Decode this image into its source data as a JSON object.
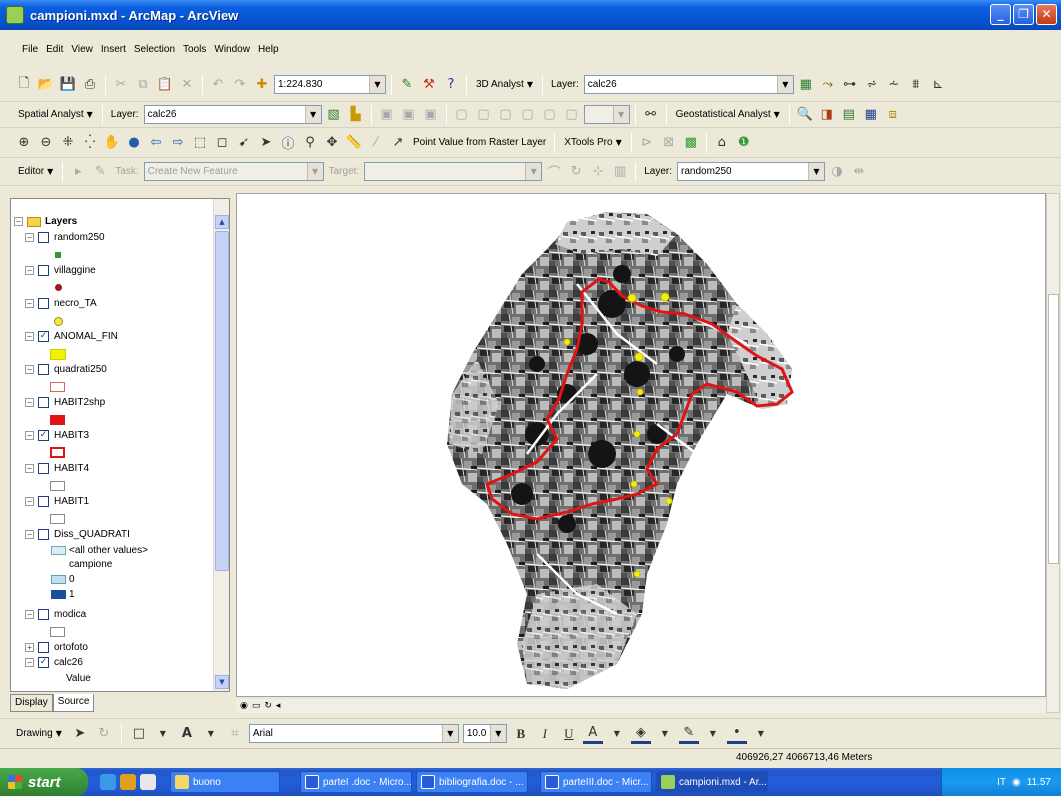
{
  "window": {
    "title": "campioni.mxd - ArcMap - ArcView"
  },
  "menu": [
    "File",
    "Edit",
    "View",
    "Insert",
    "Selection",
    "Tools",
    "Window",
    "Help"
  ],
  "standard_toolbar": {
    "scale": "1:224.830",
    "analyst3d": "3D Analyst",
    "layer_label": "Layer:",
    "layer_value": "calc26"
  },
  "spatial_toolbar": {
    "spatial_analyst": "Spatial Analyst",
    "layer_label": "Layer:",
    "layer_value": "calc26",
    "geostat": "Geostatistical Analyst"
  },
  "tools_toolbar": {
    "point_value": "Point Value from Raster Layer",
    "xtools": "XTools Pro"
  },
  "editor_toolbar": {
    "editor": "Editor",
    "task_label": "Task:",
    "task_value": "Create New Feature",
    "target_label": "Target:",
    "layer_label": "Layer:",
    "layer_value": "random250"
  },
  "toc": {
    "root": "Layers",
    "layers": [
      {
        "name": "random250",
        "checked": false
      },
      {
        "name": "villaggine",
        "checked": false
      },
      {
        "name": "necro_TA",
        "checked": false
      },
      {
        "name": "ANOMAL_FIN",
        "checked": true
      },
      {
        "name": "quadrati250",
        "checked": false
      },
      {
        "name": "HABIT2shp",
        "checked": false
      },
      {
        "name": "HABIT3",
        "checked": true
      },
      {
        "name": "HABIT4",
        "checked": false
      },
      {
        "name": "HABIT1",
        "checked": false
      },
      {
        "name": "Diss_QUADRATI",
        "checked": false
      },
      {
        "name": "modica",
        "checked": false
      },
      {
        "name": "ortofoto",
        "checked": false
      },
      {
        "name": "calc26",
        "checked": true
      }
    ],
    "diss_legend": {
      "other": "<all other values>",
      "field": "campione",
      "v0": "0",
      "v1": "1"
    },
    "calc_legend": "Value",
    "tabs": {
      "display": "Display",
      "source": "Source"
    }
  },
  "drawing_toolbar": {
    "drawing": "Drawing",
    "font": "Arial",
    "size": "10.0",
    "bold": "B",
    "italic": "I",
    "underline": "U"
  },
  "status": {
    "coords": "406926,27  4066713,46 Meters"
  },
  "taskbar": {
    "start": "start",
    "tasks": [
      "buono",
      "parteI .doc - Micro...",
      "bibliografia.doc - ...",
      "parteIII.doc - Micr...",
      "campioni.mxd - Ar..."
    ],
    "lang": "IT",
    "clock": "11.57"
  },
  "colors": {
    "selection_red": "#e01414",
    "anomaly_yellow": "#f2f200",
    "xp_blue": "#0853d0"
  }
}
